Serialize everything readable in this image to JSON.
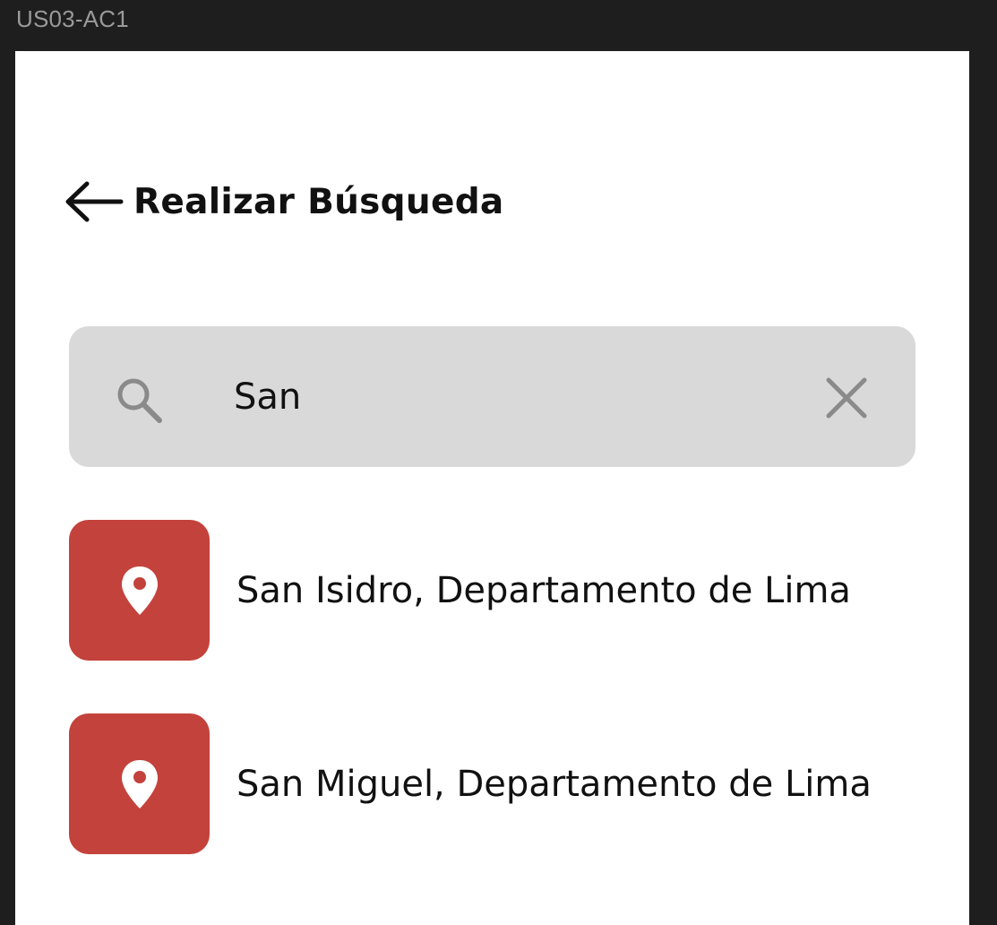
{
  "frame_label": "US03-AC1",
  "header": {
    "back_icon": "arrow-left-icon",
    "title": "Realizar Búsqueda"
  },
  "search": {
    "icon": "search-icon",
    "value": "San",
    "clear_icon": "close-icon"
  },
  "results": [
    {
      "icon": "map-pin-icon",
      "label": "San Isidro, Departamento de Lima"
    },
    {
      "icon": "map-pin-icon",
      "label": "San Miguel, Departamento de Lima"
    }
  ],
  "colors": {
    "background": "#1e1e1e",
    "frame": "#ffffff",
    "search_bar": "#d9d9d9",
    "pin_tile": "#c4423c",
    "text": "#111111",
    "icon_gray": "#8a8a8a"
  }
}
